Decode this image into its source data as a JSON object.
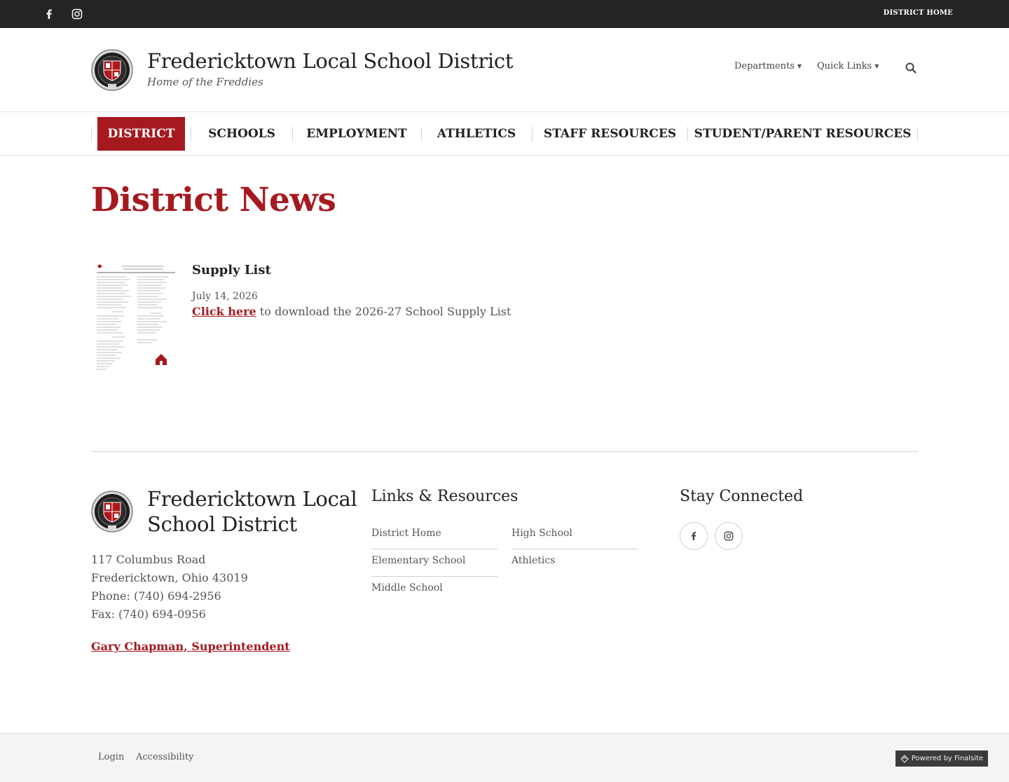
{
  "topbar": {
    "social": [
      {
        "name": "facebook-icon"
      },
      {
        "name": "instagram-icon"
      }
    ],
    "district_home_label": "DISTRICT HOME"
  },
  "header": {
    "title": "Fredericktown Local School District",
    "tagline": "Home of the Freddies",
    "utility": [
      {
        "label": "Departments"
      },
      {
        "label": "Quick Links"
      }
    ],
    "search_icon": "search-icon"
  },
  "nav": {
    "items": [
      {
        "label": "DISTRICT",
        "active": true
      },
      {
        "label": "SCHOOLS"
      },
      {
        "label": "EMPLOYMENT"
      },
      {
        "label": "ATHLETICS"
      },
      {
        "label": "STAFF RESOURCES"
      },
      {
        "label": "STUDENT/PARENT RESOURCES"
      }
    ]
  },
  "page": {
    "title": "District News"
  },
  "news": [
    {
      "title": "Supply List",
      "date": "July 14, 2026",
      "link_text": "Click here",
      "body": " to download the 2026-27 School Supply List"
    }
  ],
  "footer": {
    "title_line1": "Fredericktown Local",
    "title_line2": "School District",
    "address": [
      "117 Columbus Road",
      "Fredericktown, Ohio 43019",
      "Phone: (740) 694-2956",
      "Fax: (740) 694-0956"
    ],
    "superintendent": "Gary Chapman, Superintendent",
    "links_heading": "Links & Resources",
    "links": [
      "District Home",
      "High School",
      "Elementary School",
      "Athletics",
      "Middle School"
    ],
    "connect_heading": "Stay Connected"
  },
  "bottombar": {
    "login": "Login",
    "accessibility": "Accessibility",
    "powered_by": "Powered by Finalsite"
  },
  "colors": {
    "accent": "#a5191f",
    "topbar": "#242424",
    "text": "#222222"
  }
}
